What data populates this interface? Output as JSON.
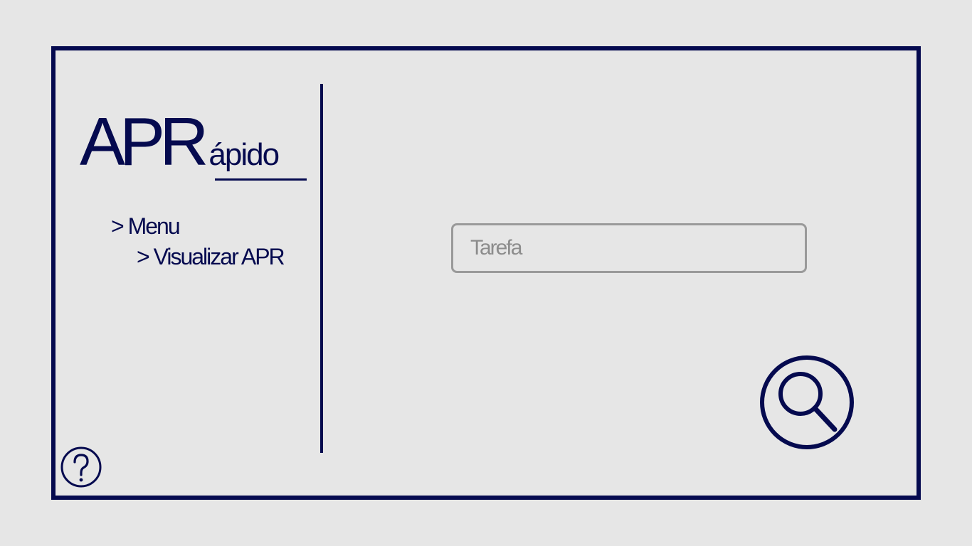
{
  "logo": {
    "main": "APR",
    "sub": "ápido"
  },
  "nav": {
    "menu_label": "> Menu",
    "current_label": "> Visualizar APR"
  },
  "search": {
    "placeholder": "Tarefa",
    "value": ""
  },
  "icons": {
    "search_button": "search-icon",
    "help_button": "question-mark-icon"
  },
  "colors": {
    "accent": "#050a4f",
    "background": "#e6e6e6",
    "input_border": "#9a9a9a"
  }
}
